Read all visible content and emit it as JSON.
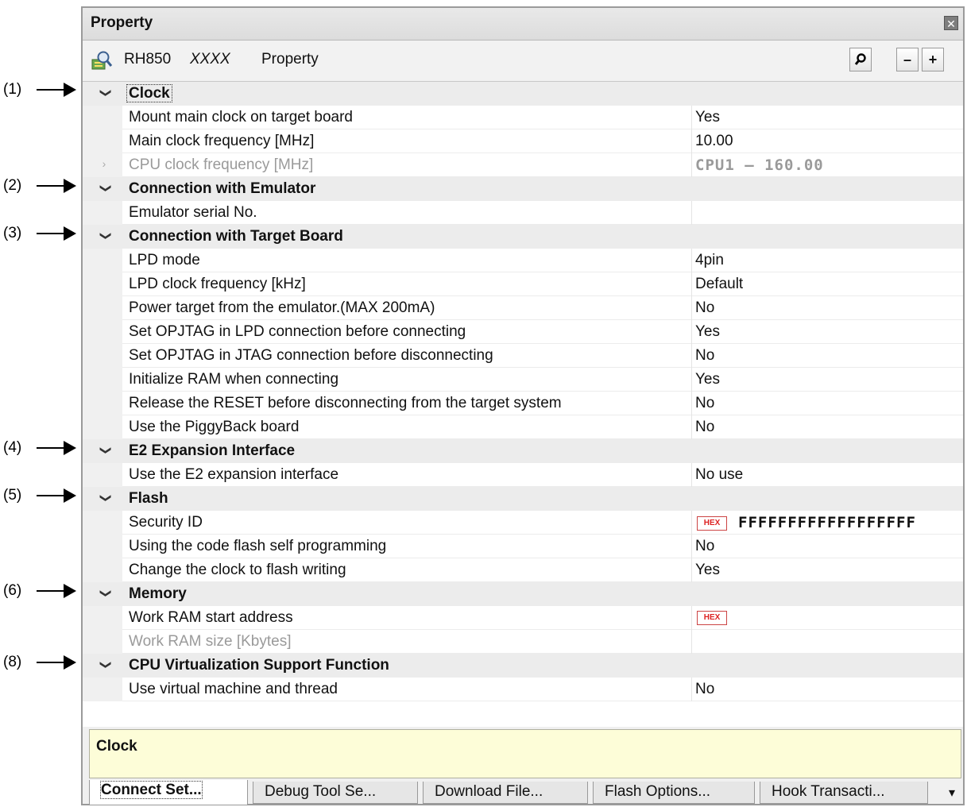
{
  "callouts": [
    "(1)",
    "(2)",
    "(3)",
    "(4)",
    "(5)",
    "(6)",
    "(8)"
  ],
  "panel": {
    "title": "Property"
  },
  "toolbar": {
    "device": "RH850",
    "model": "XXXX",
    "label": "Property",
    "minus": "–",
    "plus": "+"
  },
  "categories": {
    "clock": "Clock",
    "emulator": "Connection with Emulator",
    "target": "Connection with Target Board",
    "e2": "E2 Expansion Interface",
    "flash": "Flash",
    "memory": "Memory",
    "cpuvirt": "CPU Virtualization Support Function"
  },
  "props": {
    "mount_main_clock": {
      "name": "Mount main clock on target board",
      "value": "Yes"
    },
    "main_clock_freq": {
      "name": "Main clock frequency [MHz]",
      "value": "10.00"
    },
    "cpu_clock_freq": {
      "name": "CPU clock frequency [MHz]",
      "value": "CPU1 – 160.00"
    },
    "emulator_serial": {
      "name": "Emulator serial No.",
      "value": ""
    },
    "lpd_mode": {
      "name": "LPD mode",
      "value": "4pin"
    },
    "lpd_clock": {
      "name": "LPD clock frequency [kHz]",
      "value": "Default"
    },
    "power_target": {
      "name": "Power target from the emulator.(MAX 200mA)",
      "value": "No"
    },
    "opjtag_lpd": {
      "name": "Set OPJTAG in LPD connection before connecting",
      "value": "Yes"
    },
    "opjtag_jtag": {
      "name": "Set OPJTAG in JTAG connection before disconnecting",
      "value": "No"
    },
    "init_ram": {
      "name": "Initialize RAM when connecting",
      "value": "Yes"
    },
    "release_reset": {
      "name": "Release the RESET before disconnecting from the target system",
      "value": "No"
    },
    "piggyback": {
      "name": "Use the PiggyBack board",
      "value": "No"
    },
    "use_e2": {
      "name": "Use the E2 expansion interface",
      "value": "No use"
    },
    "security_id": {
      "name": "Security ID",
      "value": "FFFFFFFFFFFFFFFFFF"
    },
    "code_flash_self": {
      "name": "Using the code flash self programming",
      "value": "No"
    },
    "change_clock": {
      "name": "Change the clock to flash writing",
      "value": "Yes"
    },
    "work_ram_start": {
      "name": "Work RAM start address",
      "value": ""
    },
    "work_ram_size": {
      "name": "Work RAM size [Kbytes]",
      "value": ""
    },
    "virtual_machine": {
      "name": "Use virtual machine and thread",
      "value": "No"
    }
  },
  "hex_badge": "HEX",
  "description": "Clock",
  "tabs": [
    "Connect Set...",
    "Debug Tool Se...",
    "Download File...",
    "Flash Options...",
    "Hook Transacti..."
  ],
  "tab_more": "▾",
  "icons": {
    "toolbar": "property-search-icon",
    "search": "magnifier-icon",
    "close": "close-icon",
    "expanded": "chevron-down-icon",
    "collapsed": "chevron-right-icon"
  }
}
